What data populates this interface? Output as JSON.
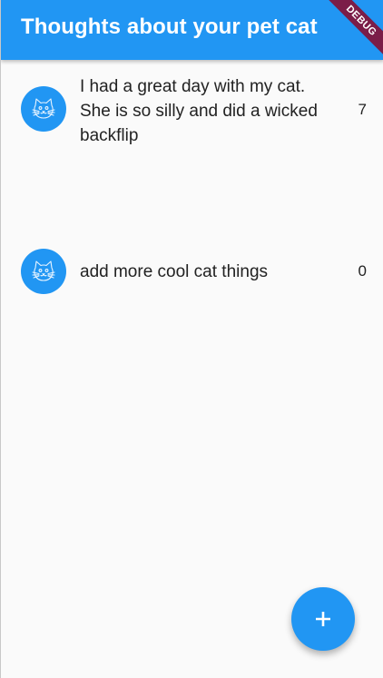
{
  "app_bar": {
    "title": "Thoughts about your pet cat",
    "debug_label": "DEBUG"
  },
  "thoughts": [
    {
      "text": "I had a great day with my cat. She is so silly and did a wicked backflip",
      "count": "7",
      "icon": "cat-face-icon"
    },
    {
      "text": "add more cool cat things",
      "count": "0",
      "icon": "cat-face-icon"
    }
  ],
  "fab": {
    "icon": "plus-icon"
  },
  "colors": {
    "primary": "#2196f3",
    "debug_banner": "#7b1d48",
    "background": "#fafafa",
    "text": "#222222"
  }
}
